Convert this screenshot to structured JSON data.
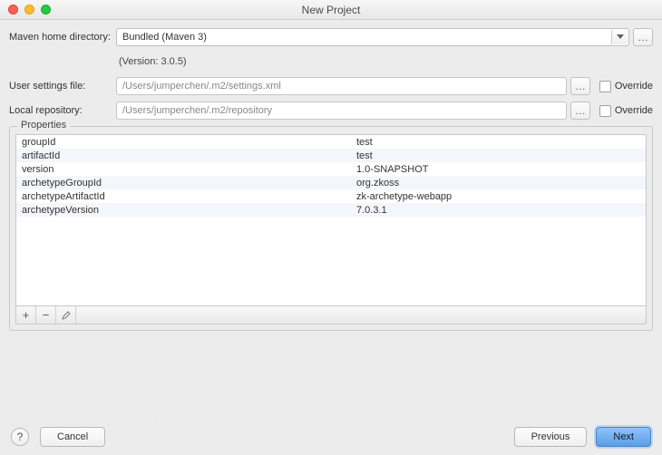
{
  "window": {
    "title": "New Project"
  },
  "fields": {
    "maven_home_label": "Maven home directory:",
    "maven_home_value": "Bundled (Maven 3)",
    "version_note": "(Version: 3.0.5)",
    "user_settings_label": "User settings file:",
    "user_settings_value": "/Users/jumperchen/.m2/settings.xml",
    "local_repo_label": "Local repository:",
    "local_repo_value": "/Users/jumperchen/.m2/repository",
    "override_label": "Override"
  },
  "properties": {
    "title": "Properties",
    "rows": [
      {
        "key": "groupId",
        "value": "test"
      },
      {
        "key": "artifactId",
        "value": "test"
      },
      {
        "key": "version",
        "value": "1.0-SNAPSHOT"
      },
      {
        "key": "archetypeGroupId",
        "value": "org.zkoss"
      },
      {
        "key": "archetypeArtifactId",
        "value": "zk-archetype-webapp"
      },
      {
        "key": "archetypeVersion",
        "value": "7.0.3.1"
      }
    ]
  },
  "footer": {
    "help": "?",
    "cancel": "Cancel",
    "previous": "Previous",
    "next": "Next"
  },
  "icons": {
    "ellipsis": "…",
    "plus": "+",
    "minus": "−"
  }
}
